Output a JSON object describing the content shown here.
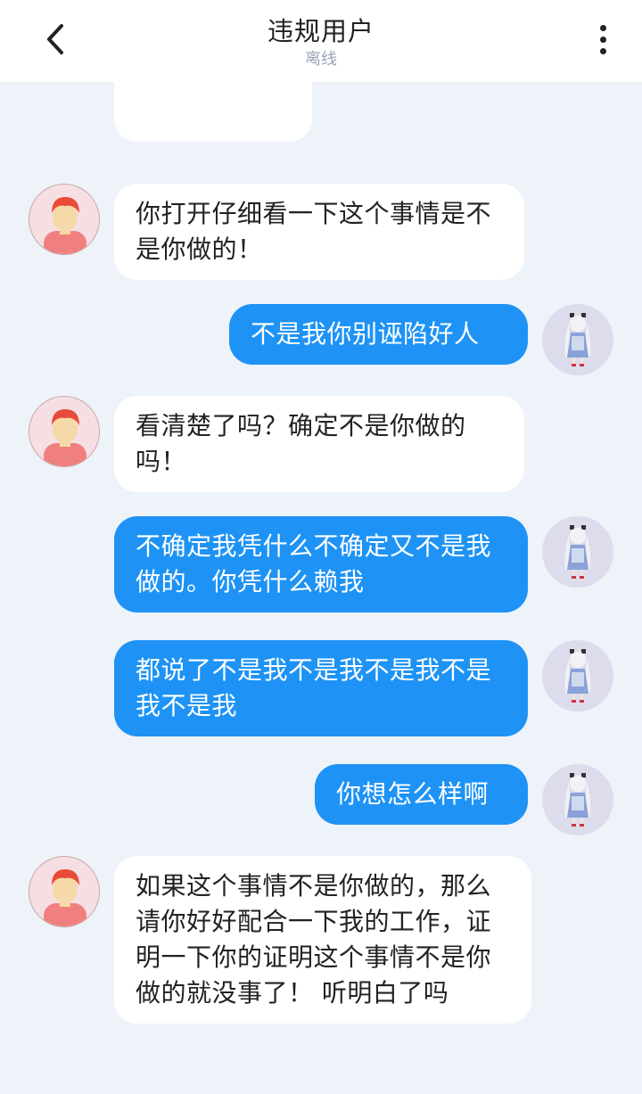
{
  "header": {
    "title": "违规用户",
    "status": "离线"
  },
  "messages": [
    {
      "side": "in",
      "text": "你打开仔细看一下这个事情是不是你做的！"
    },
    {
      "side": "out",
      "text": "不是我你别诬陷好人"
    },
    {
      "side": "in",
      "text": "看清楚了吗？确定不是你做的吗！"
    },
    {
      "side": "out",
      "text": "不确定我凭什么不确定又不是我做的。你凭什么赖我"
    },
    {
      "side": "out",
      "text": "都说了不是我不是我不是我不是我不是我"
    },
    {
      "side": "out",
      "text": "你想怎么样啊"
    },
    {
      "side": "in",
      "text": "如果这个事情不是你做的，那么请你好好配合一下我的工作，证明一下你的证明这个事情不是你做的就没事了！ 听明白了吗"
    }
  ],
  "colors": {
    "background": "#eef2f9",
    "outgoing_bubble": "#1e93f5",
    "incoming_bubble": "#ffffff"
  }
}
